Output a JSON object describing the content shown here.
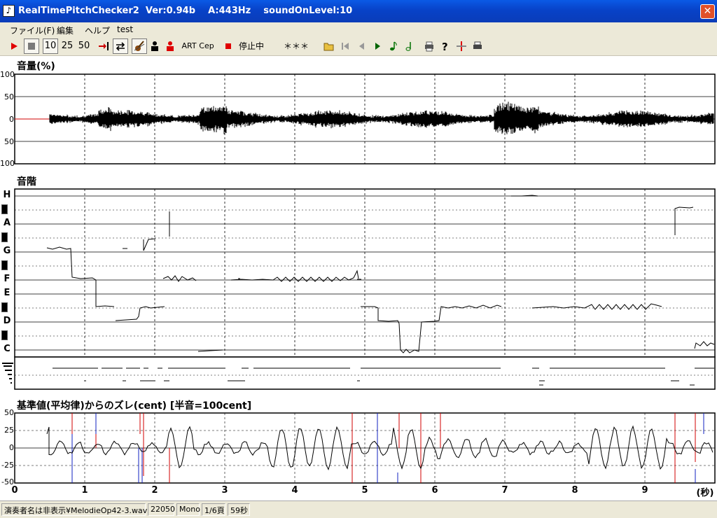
{
  "window": {
    "app_icon": "violin-clef-icon",
    "title": "RealTimePitchChecker2  Ver:0.94b    A:443Hz    soundOnLevel:10"
  },
  "menu": [
    "ファイル(F)",
    "編集",
    "ヘルプ",
    "test"
  ],
  "toolbar": {
    "zoom_buttons": [
      "10",
      "25",
      "50"
    ],
    "art_label": "ART",
    "cep_label": "Cep",
    "status_label": "停止中",
    "status_value": "＊＊＊"
  },
  "volume_panel": {
    "title": "音量(%)",
    "y_ticks": [
      "100",
      "50",
      "0",
      "50",
      "100"
    ]
  },
  "pitch_panel": {
    "title": "音階",
    "notes": [
      "H",
      "A",
      "G",
      "F",
      "E",
      "D",
      "C"
    ]
  },
  "deviation_panel": {
    "title": "基準値(平均律)からのズレ(cent) [半音=100cent]",
    "y_ticks": [
      "50",
      "25",
      "0",
      "-25",
      "-50"
    ]
  },
  "time_axis": {
    "labels": [
      "0",
      "1",
      "2",
      "3",
      "4",
      "5",
      "6",
      "7",
      "8",
      "9"
    ],
    "unit": "(秒)"
  },
  "statusbar": {
    "file": "演奏者名は非表示¥MelodieOp42-3.wav",
    "rate": "22050",
    "channels": "Mono",
    "page": "1/6頁",
    "length": "59秒"
  }
}
